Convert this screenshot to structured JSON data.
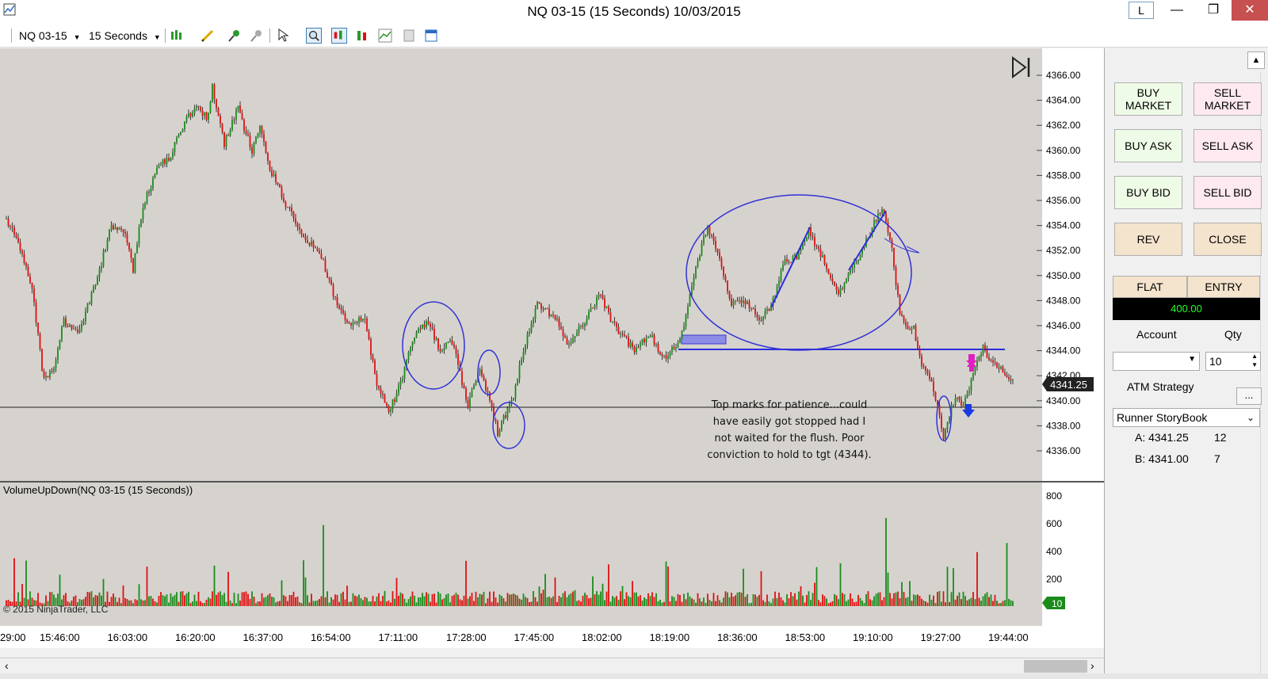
{
  "window": {
    "title": "NQ 03-15 (15 Seconds)  10/03/2015",
    "l_button": "L",
    "minimize": "—",
    "maximize": "❐",
    "close": "✕"
  },
  "toolbar": {
    "instrument": "NQ 03-15",
    "interval": "15 Seconds",
    "icons": [
      "bar-type-icon",
      "draw-pencil-icon",
      "pin-icon",
      "pin-gray-icon",
      "cursor-icon",
      "zoom-icon",
      "candles-icon",
      "bars-icon",
      "line-chart-icon",
      "data-box-icon",
      "properties-icon"
    ]
  },
  "chart": {
    "price_ticks": [
      "4366.00",
      "4364.00",
      "4362.00",
      "4360.00",
      "4358.00",
      "4356.00",
      "4354.00",
      "4352.00",
      "4350.00",
      "4348.00",
      "4346.00",
      "4344.00",
      "4342.00",
      "4340.00",
      "4338.00",
      "4336.00"
    ],
    "last_price": "4341.25",
    "indicator_label": "VolumeUpDown(NQ 03-15 (15 Seconds))",
    "volume_ticks": [
      "800",
      "600",
      "400",
      "200"
    ],
    "volume_last": "10",
    "copyright": "© 2015 NinjaTrader, LLC",
    "time_ticks": [
      "29:00",
      "15:46:00",
      "16:03:00",
      "16:20:00",
      "16:37:00",
      "16:54:00",
      "17:11:00",
      "17:28:00",
      "17:45:00",
      "18:02:00",
      "18:19:00",
      "18:36:00",
      "18:53:00",
      "19:10:00",
      "19:27:00",
      "19:44:00"
    ],
    "annotation": [
      "Top marks for patience...could",
      "have easily got stopped had I",
      "not waited for the flush. Poor",
      "conviction to hold to tgt (4344)."
    ],
    "colors": {
      "up": "#1a8c1a",
      "down": "#e01010",
      "annot": "#3333cc",
      "background": "#d6d3cf"
    }
  },
  "order_panel": {
    "buy_market": "BUY MARKET",
    "sell_market": "SELL MARKET",
    "buy_ask": "BUY ASK",
    "sell_ask": "SELL ASK",
    "buy_bid": "BUY BID",
    "sell_bid": "SELL BID",
    "rev": "REV",
    "close": "CLOSE",
    "flat": "FLAT",
    "entry": "ENTRY",
    "position_value": "400.00",
    "account_label": "Account",
    "qty_label": "Qty",
    "qty_value": "10",
    "atm_label": "ATM Strategy",
    "atm_button": "...",
    "atm_value": "Runner StoryBook",
    "ask_label": "A: 4341.25",
    "ask_size": "12",
    "bid_label": "B: 4341.00",
    "bid_size": "7"
  }
}
